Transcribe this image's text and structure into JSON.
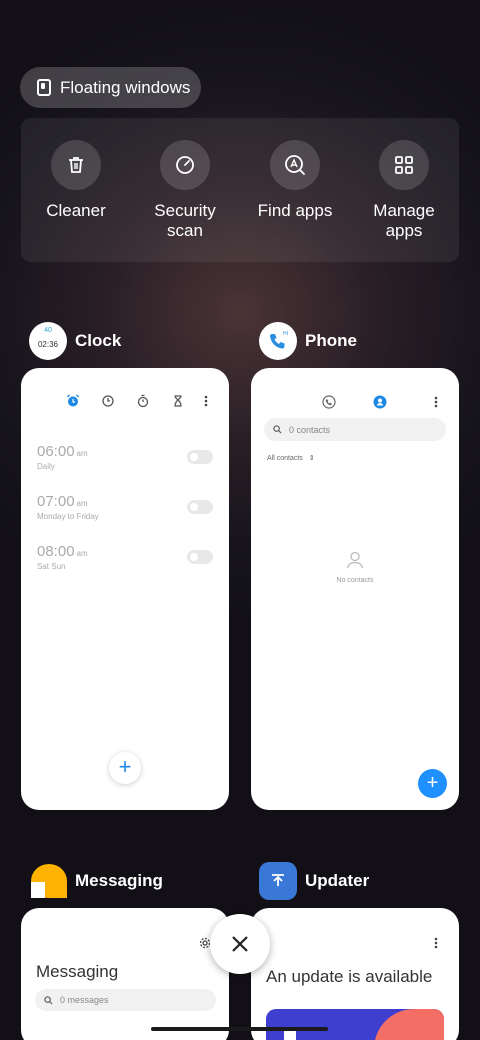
{
  "floating_windows": {
    "label": "Floating windows"
  },
  "tools": [
    {
      "label": "Cleaner",
      "icon": "trash-icon"
    },
    {
      "label": "Security scan",
      "label_line1": "Security",
      "label_line2": "scan",
      "icon": "shield-check-icon"
    },
    {
      "label": "Find apps",
      "icon": "find-apps-icon"
    },
    {
      "label": "Manage apps",
      "label_line1": "Manage",
      "label_line2": "apps",
      "icon": "grid-icon"
    }
  ],
  "apps": {
    "clock": {
      "title": "Clock",
      "icon_top": "40",
      "icon_time": "02:36",
      "alarms": [
        {
          "time": "06:00",
          "ampm": "am",
          "sub": "Daily"
        },
        {
          "time": "07:00",
          "ampm": "am",
          "sub": "Monday to Friday"
        },
        {
          "time": "08:00",
          "ampm": "am",
          "sub": "Sat Sun"
        }
      ],
      "fab": "+"
    },
    "phone": {
      "title": "Phone",
      "icon_badge": "HI",
      "search_placeholder": "0 contacts",
      "filter": "All contacts",
      "empty": "No contacts",
      "fab": "+"
    },
    "messaging": {
      "title": "Messaging",
      "heading": "Messaging",
      "search_placeholder": "0 messages"
    },
    "updater": {
      "title": "Updater",
      "heading": "An update is available"
    }
  },
  "colors": {
    "accent": "#1e88e5",
    "fab_blue": "#1e90ff",
    "updater_icon": "#3a78d8",
    "messaging_icon": "#ffb300"
  }
}
